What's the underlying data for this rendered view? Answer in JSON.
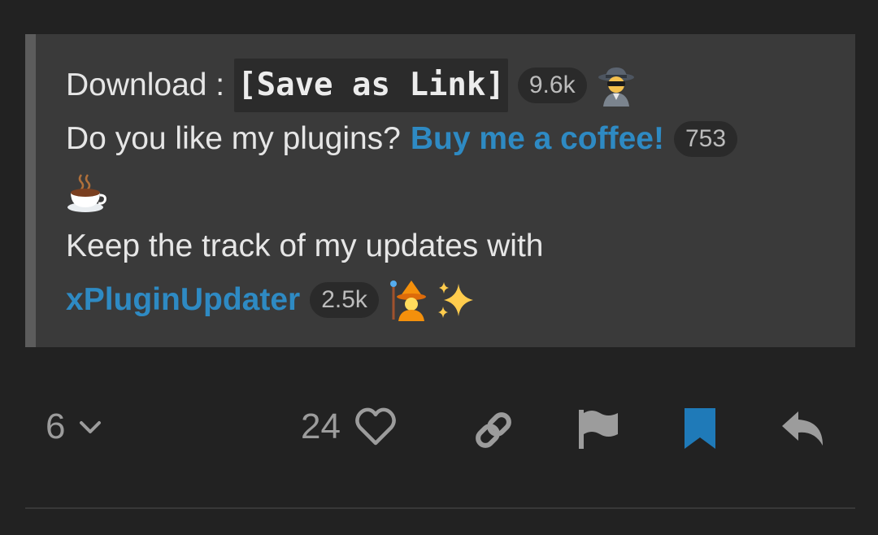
{
  "post": {
    "download_label": "Download :",
    "download_code": "[Save as Link]",
    "download_count": "9.6k",
    "plugins_question": "Do you like my plugins?",
    "coffee_link": "Buy me a coffee!",
    "coffee_count": "753",
    "updates_text": "Keep the track of my updates with",
    "updater_link": "xPluginUpdater",
    "updater_count": "2.5k"
  },
  "icons": {
    "spy": "detective-icon",
    "coffee": "hot-beverage-icon",
    "wizard": "mage-icon",
    "sparkles": "sparkles-icon"
  },
  "actions": {
    "replies_count": "6",
    "likes_count": "24"
  },
  "colors": {
    "background": "#222222",
    "quote_background": "#3a3a3a",
    "link": "#2e8ac3",
    "bookmark": "#1f7ab8",
    "muted": "#9c9c9c"
  }
}
